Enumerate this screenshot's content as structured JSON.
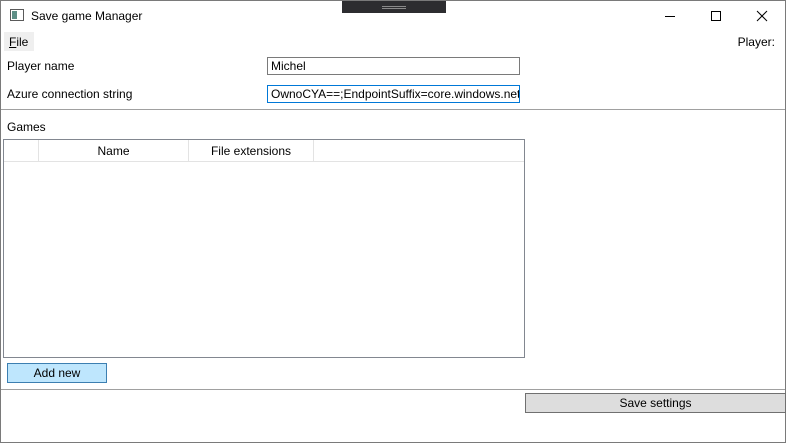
{
  "window": {
    "title": "Save game Manager"
  },
  "menu": {
    "file_accel": "F",
    "file_rest": "ile"
  },
  "header": {
    "player_label": "Player:"
  },
  "form": {
    "player_name_label": "Player name",
    "player_name_value": "Michel",
    "azure_label": "Azure connection string",
    "azure_value": "OwnoCYA==;EndpointSuffix=core.windows.net"
  },
  "games": {
    "section_label": "Games",
    "columns": [
      "Name",
      "File extensions"
    ],
    "rows": []
  },
  "buttons": {
    "add_new": "Add new",
    "save_settings": "Save settings"
  },
  "colors": {
    "add_button_bg": "#bee6fd",
    "add_button_border": "#3c7fb1",
    "focus_border": "#0078d7",
    "save_button_bg": "#dddddd"
  }
}
